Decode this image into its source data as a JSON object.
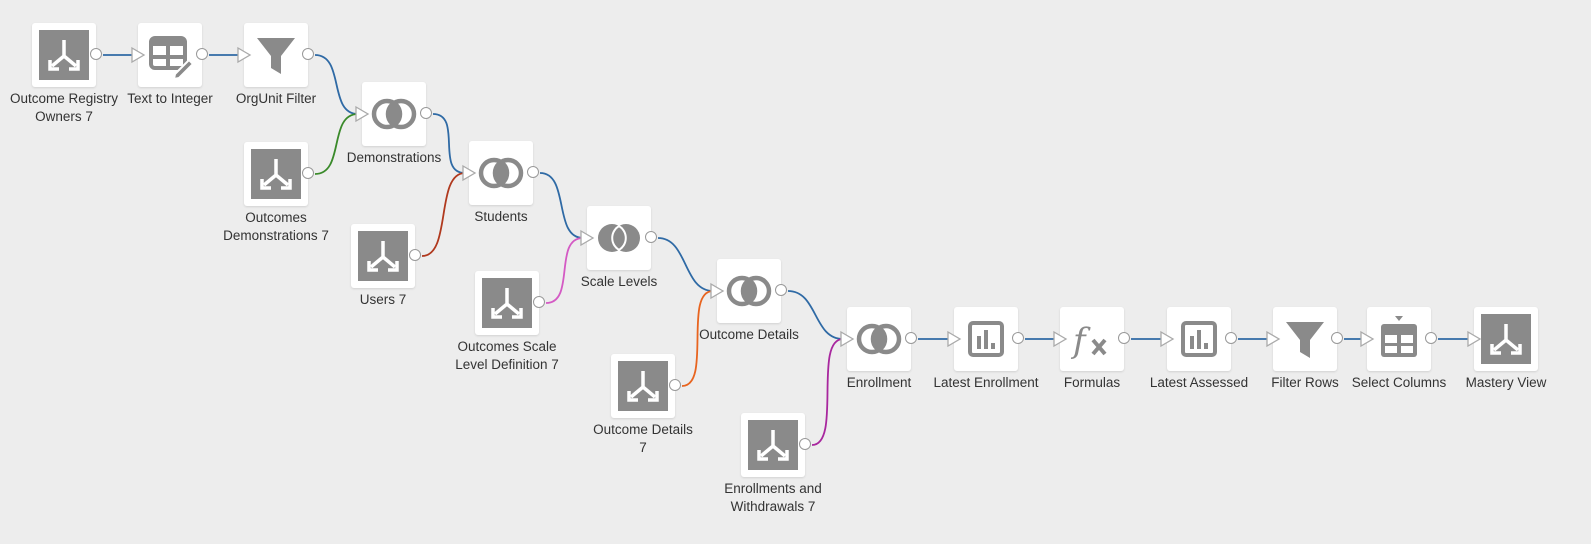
{
  "colors": {
    "background": "#ededed",
    "node_bg": "#ffffff",
    "icon": "#8a8a8a",
    "edge_blue": "#2f6aa5",
    "edge_green": "#3a8a2a",
    "edge_red": "#b0391e",
    "edge_pink": "#d45ac4",
    "edge_orange": "#e8641f",
    "edge_purple": "#a8279e"
  },
  "nodes": [
    {
      "id": "n1",
      "label": "Outcome Registry\nOwners 7",
      "icon": "dataset-input-icon"
    },
    {
      "id": "n2",
      "label": "Text to Integer",
      "icon": "edit-table-icon"
    },
    {
      "id": "n3",
      "label": "OrgUnit Filter",
      "icon": "filter-icon"
    },
    {
      "id": "n4",
      "label": "Outcomes\nDemonstrations 7",
      "icon": "dataset-input-icon"
    },
    {
      "id": "n5",
      "label": "Demonstrations",
      "icon": "join-icon"
    },
    {
      "id": "n6",
      "label": "Users 7",
      "icon": "dataset-input-icon"
    },
    {
      "id": "n7",
      "label": "Students",
      "icon": "join-icon"
    },
    {
      "id": "n8",
      "label": "Outcomes Scale\nLevel Definition 7",
      "icon": "dataset-input-icon"
    },
    {
      "id": "n9",
      "label": "Scale Levels",
      "icon": "outer-join-icon"
    },
    {
      "id": "n10",
      "label": "Outcome Details\n7",
      "icon": "dataset-input-icon"
    },
    {
      "id": "n11",
      "label": "Outcome Details",
      "icon": "join-icon"
    },
    {
      "id": "n12",
      "label": "Enrollments and\nWithdrawals 7",
      "icon": "dataset-input-icon"
    },
    {
      "id": "n13",
      "label": "Enrollment",
      "icon": "join-icon"
    },
    {
      "id": "n14",
      "label": "Latest Enrollment",
      "icon": "rank-icon"
    },
    {
      "id": "n15",
      "label": "Formulas",
      "icon": "formula-icon"
    },
    {
      "id": "n16",
      "label": "Latest Assessed",
      "icon": "rank-icon"
    },
    {
      "id": "n17",
      "label": "Filter Rows",
      "icon": "filter-icon"
    },
    {
      "id": "n18",
      "label": "Select Columns",
      "icon": "select-columns-icon"
    },
    {
      "id": "n19",
      "label": "Mastery View",
      "icon": "dataset-output-icon"
    }
  ],
  "edges": [
    {
      "from": "n1",
      "to": "n2",
      "color": "edge_blue"
    },
    {
      "from": "n2",
      "to": "n3",
      "color": "edge_blue"
    },
    {
      "from": "n3",
      "to": "n5",
      "color": "edge_blue"
    },
    {
      "from": "n4",
      "to": "n5",
      "color": "edge_green"
    },
    {
      "from": "n5",
      "to": "n7",
      "color": "edge_blue"
    },
    {
      "from": "n6",
      "to": "n7",
      "color": "edge_red"
    },
    {
      "from": "n7",
      "to": "n9",
      "color": "edge_blue"
    },
    {
      "from": "n8",
      "to": "n9",
      "color": "edge_pink"
    },
    {
      "from": "n9",
      "to": "n11",
      "color": "edge_blue"
    },
    {
      "from": "n10",
      "to": "n11",
      "color": "edge_orange"
    },
    {
      "from": "n11",
      "to": "n13",
      "color": "edge_blue"
    },
    {
      "from": "n12",
      "to": "n13",
      "color": "edge_purple"
    },
    {
      "from": "n13",
      "to": "n14",
      "color": "edge_blue"
    },
    {
      "from": "n14",
      "to": "n15",
      "color": "edge_blue"
    },
    {
      "from": "n15",
      "to": "n16",
      "color": "edge_blue"
    },
    {
      "from": "n16",
      "to": "n17",
      "color": "edge_blue"
    },
    {
      "from": "n17",
      "to": "n18",
      "color": "edge_blue"
    },
    {
      "from": "n18",
      "to": "n19",
      "color": "edge_blue"
    }
  ]
}
